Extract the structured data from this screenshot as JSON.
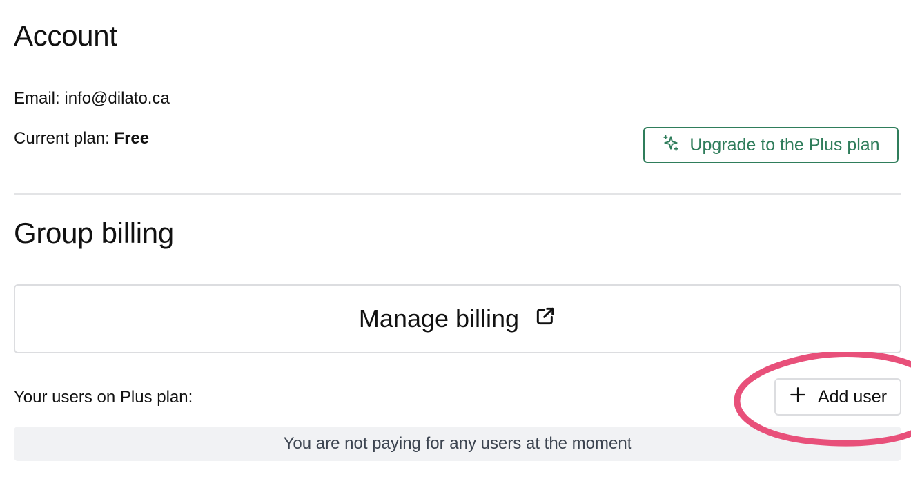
{
  "account": {
    "title": "Account",
    "email_label": "Email:",
    "email_value": "info@dilato.ca",
    "plan_label": "Current plan:",
    "plan_value": "Free",
    "upgrade_label": "Upgrade to the Plus plan",
    "upgrade_icon": "sparkles-icon"
  },
  "group_billing": {
    "title": "Group billing",
    "manage_label": "Manage billing",
    "manage_icon": "external-link-icon",
    "users_label": "Your users on Plus plan:",
    "add_user_label": "Add user",
    "add_user_icon": "plus-icon",
    "empty_message": "You are not paying for any users at the moment"
  },
  "colors": {
    "accent": "#2f7d5b",
    "highlight": "#e8507a",
    "empty_bg": "#f1f2f4"
  }
}
